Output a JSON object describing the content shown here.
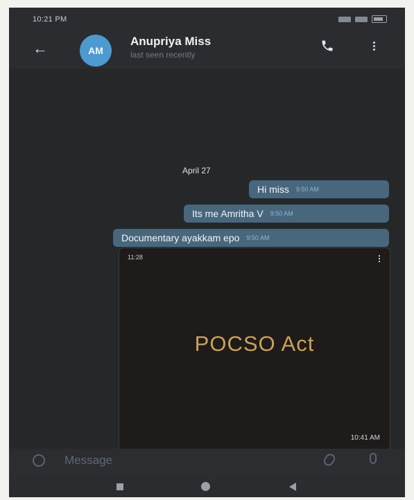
{
  "status_bar": {
    "time": "10:21 PM"
  },
  "header": {
    "avatar_initials": "AM",
    "contact_name": "Anupriya Miss",
    "contact_status": "last seen recently"
  },
  "chat": {
    "date_label": "April 27",
    "messages": [
      {
        "text": "Hi miss",
        "time": "9:50 AM"
      },
      {
        "text": "Its me Amritha V",
        "time": "9:50 AM"
      },
      {
        "text": "Documentary ayakkam epo",
        "time": "9:50 AM"
      }
    ],
    "media": {
      "inner_time": "11:28",
      "title": "POCSO Act",
      "time": "10:41 AM"
    }
  },
  "composer": {
    "placeholder": "Message"
  },
  "colors": {
    "chat_background": "#262729",
    "outgoing_bubble": "#48667c",
    "avatar": "#4d9ad0",
    "media_title": "#c9a35a"
  }
}
